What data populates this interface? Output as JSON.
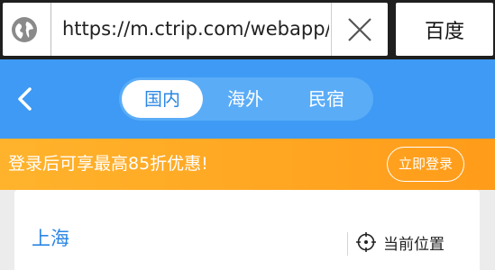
{
  "browser": {
    "url": "https://m.ctrip.com/webapp/hotel/",
    "go_label": "百度"
  },
  "header": {
    "tabs": [
      {
        "label": "国内",
        "active": true
      },
      {
        "label": "海外",
        "active": false
      },
      {
        "label": "民宿",
        "active": false
      }
    ]
  },
  "promo": {
    "text": "登录后可享最高85折优惠!",
    "login_label": "立即登录"
  },
  "search": {
    "city": "上海",
    "current_location_label": "当前位置"
  },
  "colors": {
    "header_blue": "#3e9af4",
    "accent_blue": "#2b86e3",
    "promo_orange": "#ffa424"
  },
  "icons": [
    "globe-icon",
    "close-icon",
    "back-arrow-icon",
    "locate-icon"
  ]
}
